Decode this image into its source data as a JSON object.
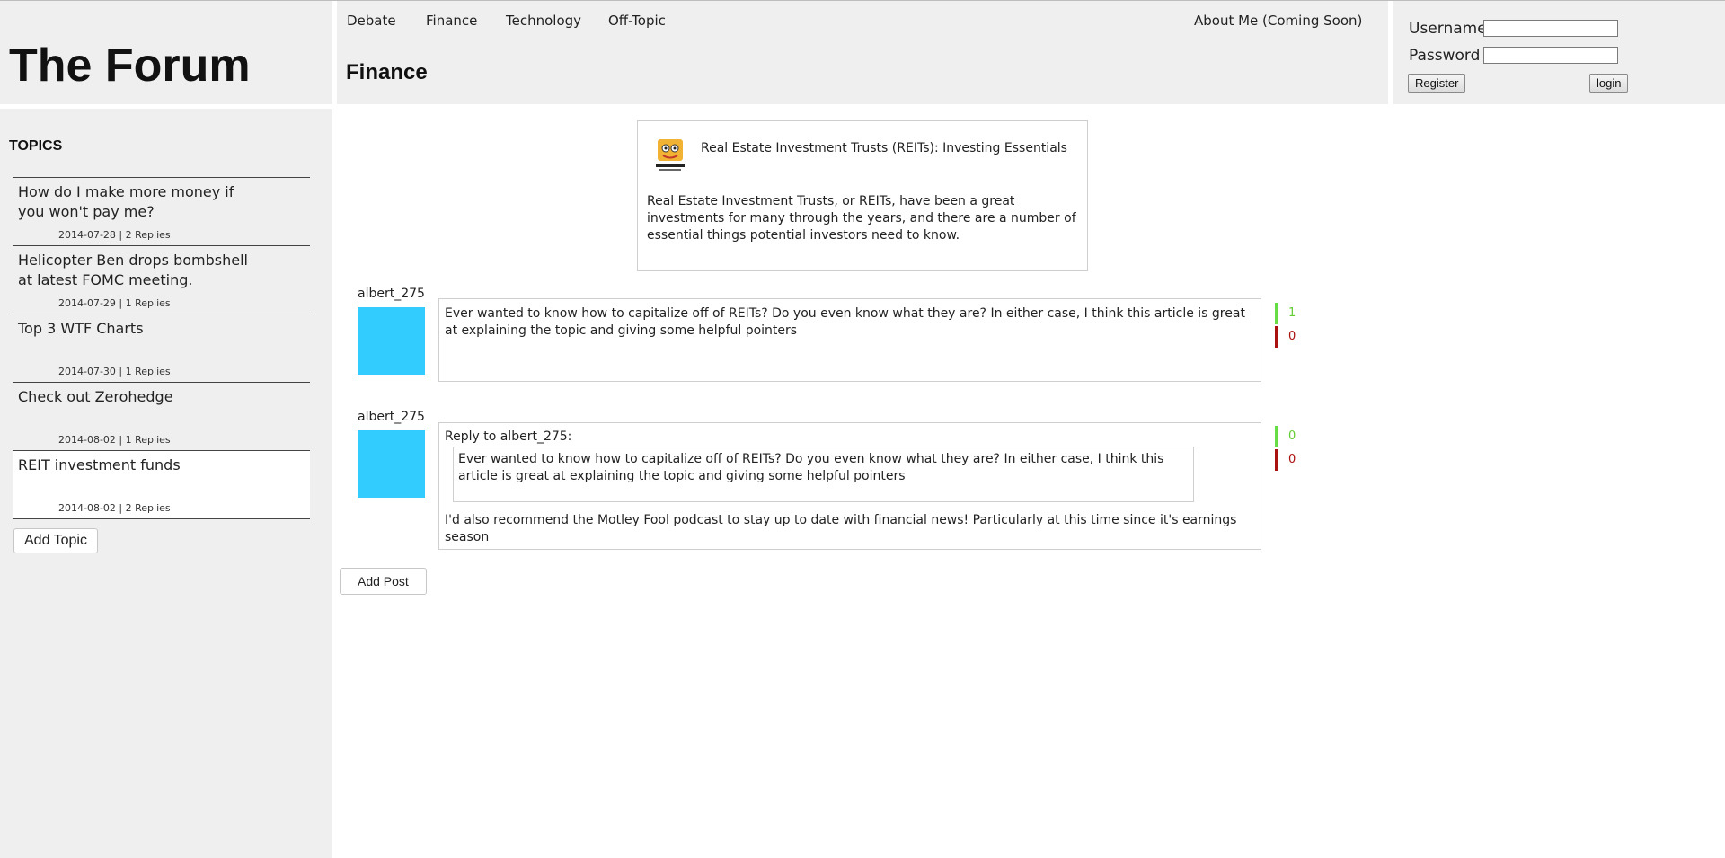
{
  "brand": {
    "title": "The Forum"
  },
  "nav": {
    "items": [
      {
        "label": "Debate"
      },
      {
        "label": "Finance"
      },
      {
        "label": "Technology"
      },
      {
        "label": "Off-Topic"
      }
    ],
    "about": "About Me (Coming Soon)"
  },
  "section": {
    "title": "Finance"
  },
  "login": {
    "username_label": "Username",
    "password_label": "Password",
    "username_value": "",
    "password_value": "",
    "register_label": "Register",
    "login_label": "login"
  },
  "sidebar": {
    "heading": "TOPICS",
    "topics": [
      {
        "title": "How do I make more money if you won't pay me?",
        "meta": "2014-07-28  |  2 Replies"
      },
      {
        "title": "Helicopter Ben drops bombshell at latest FOMC meeting.",
        "meta": "2014-07-29  |  1 Replies"
      },
      {
        "title": "Top 3 WTF Charts",
        "meta": "2014-07-30  |  1 Replies"
      },
      {
        "title": "Check out Zerohedge",
        "meta": "2014-08-02  |  1 Replies"
      },
      {
        "title": "REIT investment funds",
        "meta": "2014-08-02  |  2 Replies"
      }
    ],
    "add_topic_label": "Add Topic"
  },
  "article": {
    "logo_icon": "motley-fool-logo-icon",
    "title": "Real Estate Investment Trusts (REITs): Investing Essentials",
    "summary": "Real Estate Investment Trusts, or REITs, have been a great investments for many through the years, and there are a number of essential things potential investors need to know."
  },
  "posts": [
    {
      "author": "albert_275",
      "text": "Ever wanted to know how to capitalize off of REITs? Do you even know what they are? In either case, I think this article is great at explaining the topic and giving some helpful pointers",
      "upvotes": "1",
      "downvotes": "0"
    },
    {
      "author": "albert_275",
      "reply_to": "Reply to albert_275:",
      "quote": "Ever wanted to know how to capitalize off of REITs? Do you even know what they are? In either case, I think this article is great at explaining the topic and giving some helpful pointers",
      "text": "I'd also recommend the Motley Fool podcast to stay up to date with financial news! Particularly at this time since it's earnings season",
      "upvotes": "0",
      "downvotes": "0"
    }
  ],
  "add_post_label": "Add Post",
  "colors": {
    "panel_bg": "#efefef",
    "avatar": "#33ccff",
    "upvote": "#66dd44",
    "downvote": "#aa1111"
  }
}
